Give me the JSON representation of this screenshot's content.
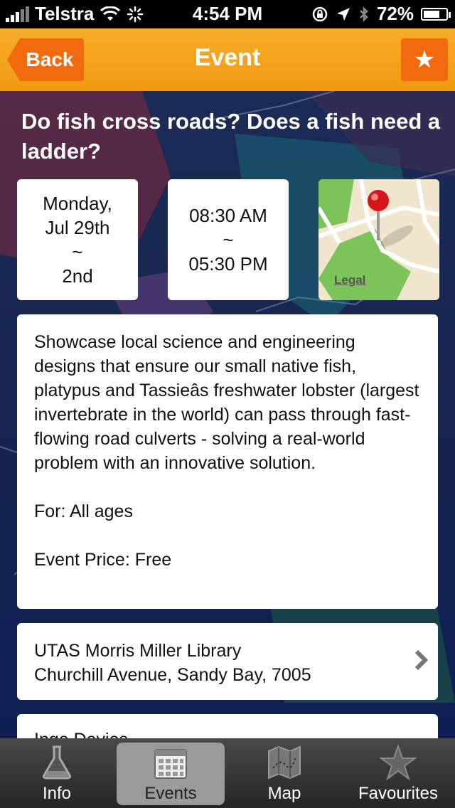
{
  "status_bar": {
    "carrier": "Telstra",
    "time": "4:54 PM",
    "battery": "72%",
    "battery_level": 0.72
  },
  "nav": {
    "back_label": "Back",
    "title": "Event",
    "star_glyph": "★"
  },
  "event": {
    "title": "Do fish cross roads? Does a fish need a ladder?",
    "date_line1": "Monday,",
    "date_line2": "Jul 29th",
    "date_sep": "~",
    "date_line3": "2nd",
    "time_start": "08:30 AM",
    "time_sep": "~",
    "time_end": "05:30 PM",
    "map_legal": "Legal",
    "description": "Showcase local science and engineering designs that ensure our small native fish, platypus and Tassieâs freshwater lobster (largest invertebrate in the world) can pass through fast-flowing road culverts - solving a  real-world problem with an innovative solution.",
    "for_text": "For: All ages",
    "price_text": "Event Price: Free",
    "location_line1": "UTAS Morris Miller Library",
    "location_line2": "Churchill Avenue, Sandy Bay, 7005",
    "next_card_text": "Inge Davies"
  },
  "tabs": [
    {
      "label": "Info",
      "icon": "flask-icon"
    },
    {
      "label": "Events",
      "icon": "calendar-icon"
    },
    {
      "label": "Map",
      "icon": "map-icon"
    },
    {
      "label": "Favourites",
      "icon": "star-icon"
    }
  ],
  "colors": {
    "nav_orange": "#f19a12",
    "button_orange": "#f26a0e",
    "background_navy": "#16244e"
  }
}
